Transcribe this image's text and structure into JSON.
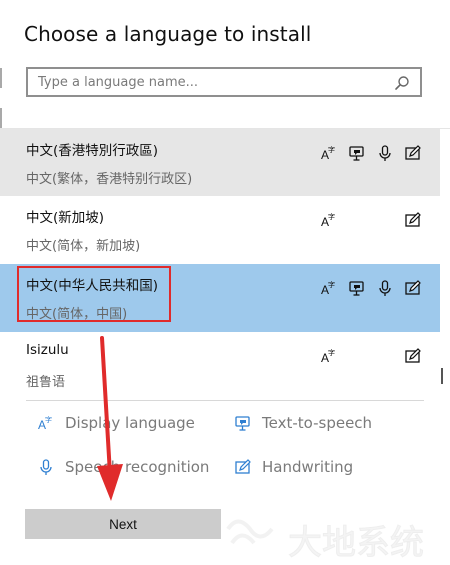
{
  "dialog": {
    "title": "Choose a language to install",
    "search": {
      "placeholder": "Type a language name..."
    },
    "languages": [
      {
        "name": "中文(香港特別行政區)",
        "subtitle": "中文(繁体，香港特别行政区)",
        "state": "hover",
        "features": [
          "display-language-icon",
          "text-to-speech-icon",
          "speech-recognition-icon",
          "handwriting-icon"
        ]
      },
      {
        "name": "中文(新加坡)",
        "subtitle": "中文(简体，新加坡)",
        "state": "normal",
        "features": [
          "display-language-icon",
          "handwriting-icon"
        ]
      },
      {
        "name": "中文(中华人民共和国)",
        "subtitle": "中文(简体，中国)",
        "state": "selected",
        "features": [
          "display-language-icon",
          "text-to-speech-icon",
          "speech-recognition-icon",
          "handwriting-icon"
        ]
      },
      {
        "name": "Isizulu",
        "subtitle": "祖鲁语",
        "state": "normal",
        "features": [
          "display-language-icon",
          "handwriting-icon"
        ]
      }
    ],
    "legend": {
      "display_language": "Display language",
      "text_to_speech": "Text-to-speech",
      "speech_recognition": "Speech recognition",
      "handwriting": "Handwriting"
    },
    "next_button": "Next"
  },
  "colors": {
    "selected_row": "#9ec9ec",
    "hover_row": "#e6e6e6",
    "annotation_red": "#e02b2b",
    "accent_blue": "#2f7fd1"
  },
  "watermark": "大地系统"
}
